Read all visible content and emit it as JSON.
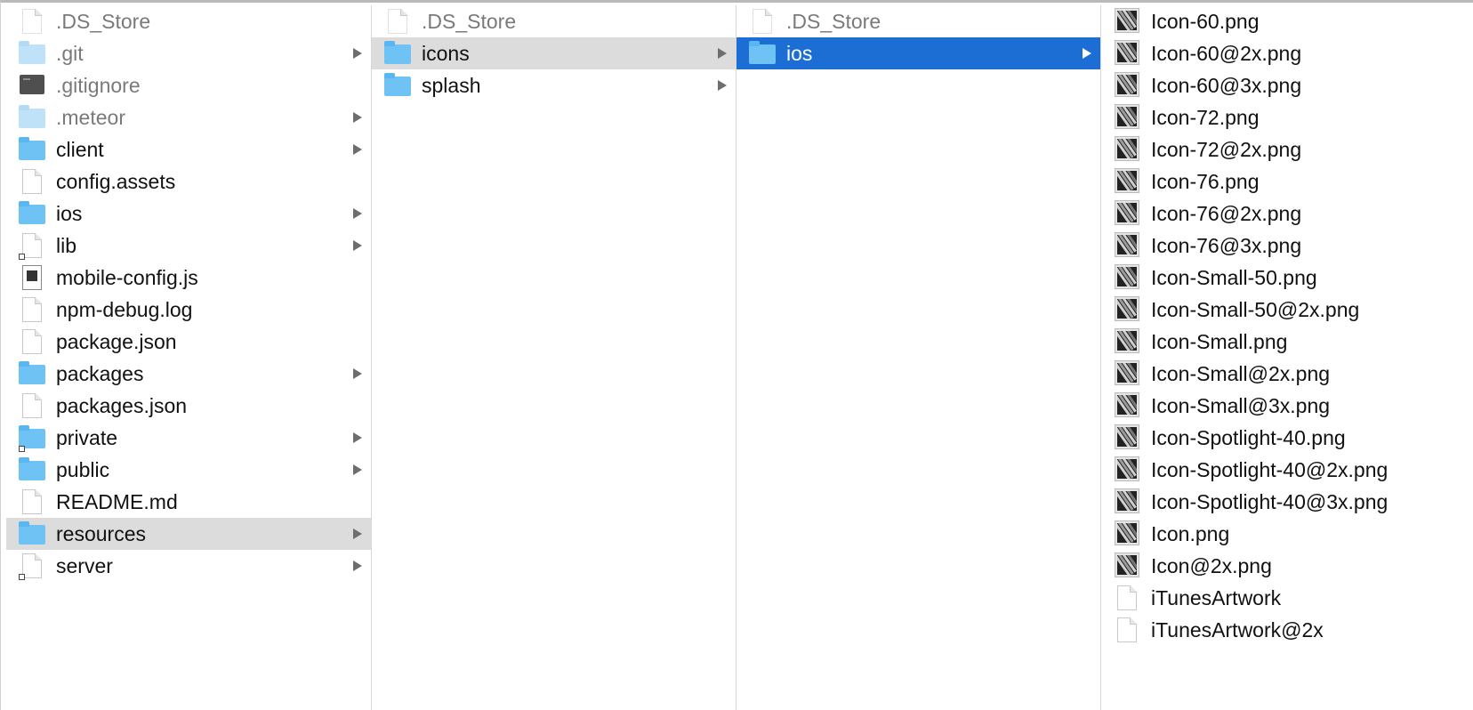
{
  "columns": [
    {
      "items": [
        {
          "label": ".DS_Store",
          "icon": "document-icon",
          "style": "dim",
          "arrow": false
        },
        {
          "label": ".git",
          "icon": "folder-icon",
          "style": "dim",
          "arrow": true
        },
        {
          "label": ".gitignore",
          "icon": "terminal-file-icon",
          "style": "dim",
          "arrow": false
        },
        {
          "label": ".meteor",
          "icon": "folder-icon",
          "style": "dim",
          "arrow": true
        },
        {
          "label": "client",
          "icon": "folder-icon",
          "style": "",
          "arrow": true
        },
        {
          "label": "config.assets",
          "icon": "document-icon",
          "style": "",
          "arrow": false
        },
        {
          "label": "ios",
          "icon": "folder-icon",
          "style": "",
          "arrow": true
        },
        {
          "label": "lib",
          "icon": "document-alias-icon",
          "style": "",
          "arrow": true
        },
        {
          "label": "mobile-config.js",
          "icon": "js-file-icon",
          "style": "",
          "arrow": false
        },
        {
          "label": "npm-debug.log",
          "icon": "document-icon",
          "style": "",
          "arrow": false
        },
        {
          "label": "package.json",
          "icon": "document-icon",
          "style": "",
          "arrow": false
        },
        {
          "label": "packages",
          "icon": "folder-icon",
          "style": "",
          "arrow": true
        },
        {
          "label": "packages.json",
          "icon": "document-icon",
          "style": "",
          "arrow": false
        },
        {
          "label": "private",
          "icon": "folder-alias-icon",
          "style": "",
          "arrow": true
        },
        {
          "label": "public",
          "icon": "folder-icon",
          "style": "",
          "arrow": true
        },
        {
          "label": "README.md",
          "icon": "document-icon",
          "style": "",
          "arrow": false
        },
        {
          "label": "resources",
          "icon": "folder-icon",
          "style": "selected-grey",
          "arrow": true
        },
        {
          "label": "server",
          "icon": "document-alias-icon",
          "style": "",
          "arrow": true
        }
      ]
    },
    {
      "items": [
        {
          "label": ".DS_Store",
          "icon": "document-icon",
          "style": "dim",
          "arrow": false
        },
        {
          "label": "icons",
          "icon": "folder-icon",
          "style": "selected-grey",
          "arrow": true
        },
        {
          "label": "splash",
          "icon": "folder-icon",
          "style": "",
          "arrow": true
        }
      ]
    },
    {
      "items": [
        {
          "label": ".DS_Store",
          "icon": "document-icon",
          "style": "dim",
          "arrow": false
        },
        {
          "label": "ios",
          "icon": "folder-icon",
          "style": "selected-blue",
          "arrow": true
        }
      ]
    },
    {
      "items": [
        {
          "label": "Icon-60.png",
          "icon": "png-image-icon",
          "style": "",
          "arrow": false
        },
        {
          "label": "Icon-60@2x.png",
          "icon": "png-image-icon",
          "style": "",
          "arrow": false
        },
        {
          "label": "Icon-60@3x.png",
          "icon": "png-image-icon",
          "style": "",
          "arrow": false
        },
        {
          "label": "Icon-72.png",
          "icon": "png-image-icon",
          "style": "",
          "arrow": false
        },
        {
          "label": "Icon-72@2x.png",
          "icon": "png-image-icon",
          "style": "",
          "arrow": false
        },
        {
          "label": "Icon-76.png",
          "icon": "png-image-icon",
          "style": "",
          "arrow": false
        },
        {
          "label": "Icon-76@2x.png",
          "icon": "png-image-icon",
          "style": "",
          "arrow": false
        },
        {
          "label": "Icon-76@3x.png",
          "icon": "png-image-icon",
          "style": "",
          "arrow": false
        },
        {
          "label": "Icon-Small-50.png",
          "icon": "png-image-icon",
          "style": "",
          "arrow": false
        },
        {
          "label": "Icon-Small-50@2x.png",
          "icon": "png-image-icon",
          "style": "",
          "arrow": false
        },
        {
          "label": "Icon-Small.png",
          "icon": "png-image-icon",
          "style": "",
          "arrow": false
        },
        {
          "label": "Icon-Small@2x.png",
          "icon": "png-image-icon",
          "style": "",
          "arrow": false
        },
        {
          "label": "Icon-Small@3x.png",
          "icon": "png-image-icon",
          "style": "",
          "arrow": false
        },
        {
          "label": "Icon-Spotlight-40.png",
          "icon": "png-image-icon",
          "style": "",
          "arrow": false
        },
        {
          "label": "Icon-Spotlight-40@2x.png",
          "icon": "png-image-icon",
          "style": "",
          "arrow": false
        },
        {
          "label": "Icon-Spotlight-40@3x.png",
          "icon": "png-image-icon",
          "style": "",
          "arrow": false
        },
        {
          "label": "Icon.png",
          "icon": "png-image-icon",
          "style": "",
          "arrow": false
        },
        {
          "label": "Icon@2x.png",
          "icon": "png-image-icon",
          "style": "",
          "arrow": false
        },
        {
          "label": "iTunesArtwork",
          "icon": "document-icon",
          "style": "",
          "arrow": false
        },
        {
          "label": "iTunesArtwork@2x",
          "icon": "document-icon",
          "style": "",
          "arrow": false
        }
      ]
    }
  ],
  "colors": {
    "selection_blue": "#1d6ed4",
    "selection_grey": "#dcdcdc",
    "folder_blue": "#6ec3f4"
  }
}
